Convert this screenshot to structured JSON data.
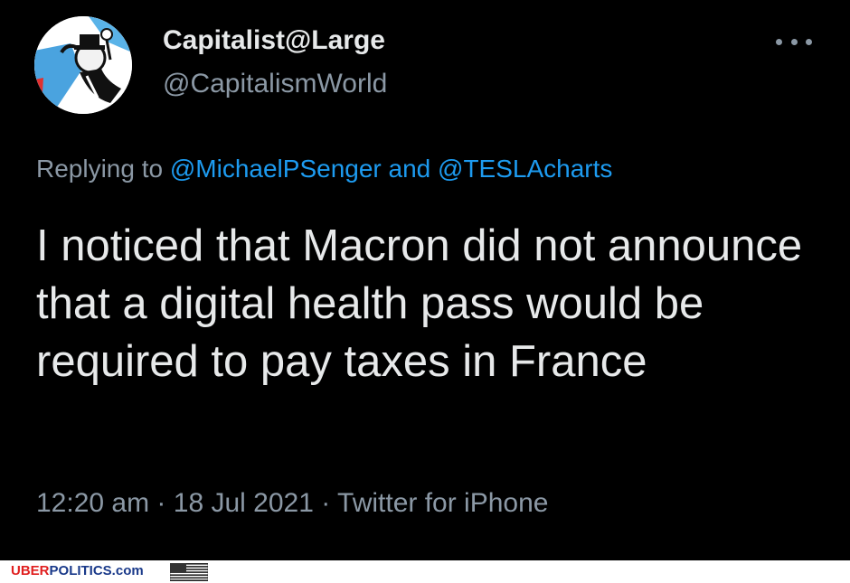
{
  "tweet": {
    "display_name": "Capitalist@Large",
    "handle": "@CapitalismWorld",
    "replying_prefix": "Replying to ",
    "reply_mention_1": "@MichaelPSenger",
    "reply_conjunction": " and ",
    "reply_mention_2": "@TESLAcharts",
    "text": "I noticed that Macron did not announce that a digital health pass would be required to pay taxes in France",
    "time": "12:20 am",
    "separator": " · ",
    "date": "18 Jul 2021",
    "source": "Twitter for iPhone"
  },
  "footer": {
    "brand_red": "UBER",
    "brand_blue": "POLITICS.com"
  },
  "colors": {
    "background": "#000000",
    "text_primary": "#e7e9ea",
    "text_secondary": "#8b98a5",
    "link": "#1d9bf0",
    "brand_red": "#e02020",
    "brand_blue": "#1a3a8a"
  },
  "icons": {
    "more": "more-horizontal-icon",
    "avatar": "monopoly-man-avatar",
    "flag": "us-flag-icon"
  }
}
